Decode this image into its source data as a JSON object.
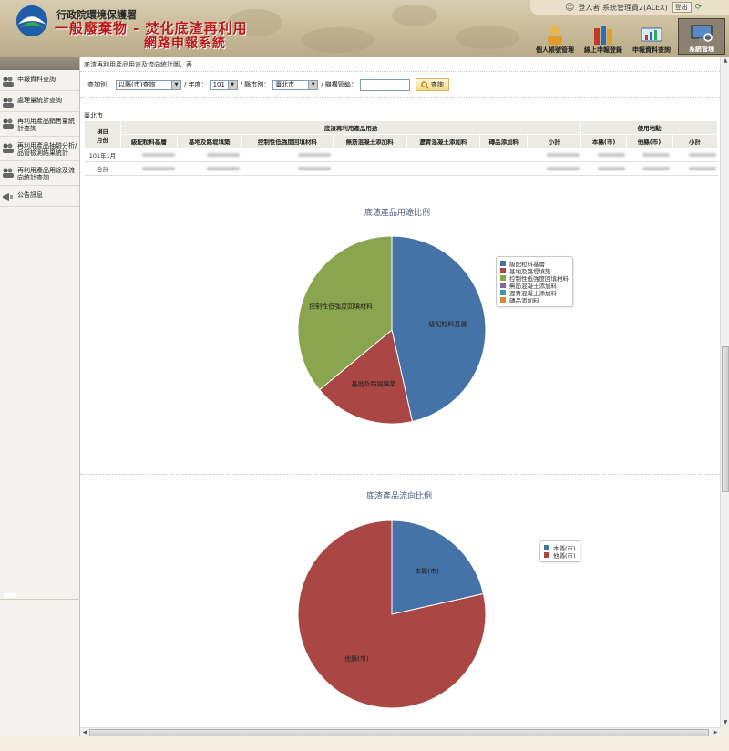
{
  "header": {
    "org": "行政院環境保護署",
    "title1": "一般廢棄物 - 焚化底渣再利用",
    "title2": "網路申報系統",
    "user_text": "登入者 系統管理員2(ALEX)",
    "logout_label": "登出",
    "nav": [
      {
        "label": "個人帳號管理",
        "icon": "person-icon"
      },
      {
        "label": "線上申報登錄",
        "icon": "books-icon"
      },
      {
        "label": "申報資料查詢",
        "icon": "chart-icon"
      },
      {
        "label": "系統管理",
        "icon": "monitor-icon"
      }
    ]
  },
  "sidebar": {
    "items": [
      {
        "label": "申報資料查詢"
      },
      {
        "label": "處理量統計查詢"
      },
      {
        "label": "再利用產品銷售量統計查詢"
      },
      {
        "label": "再利用產品抽驗分析/品管檢測結果統計"
      },
      {
        "label": "再利用產品用途及流向統計查詢"
      },
      {
        "label": "公告訊息"
      }
    ]
  },
  "breadcrumb": "底渣再利用產品用途及流向統計圖、表",
  "query": {
    "by_label": "查詢別：",
    "by_value": "以縣(市)查詢",
    "year_label": "/ 年度：",
    "year_value": "101",
    "county_label": "/ 縣市別：",
    "county_value": "臺北市",
    "keyword_label": "/ 機構管編：",
    "keyword_value": "",
    "search_label": "查詢"
  },
  "table": {
    "city": "臺北市",
    "group_usage": "底渣再利用產品用途",
    "group_location": "使用地點",
    "col_item": "項目",
    "col_month": "月份",
    "columns": [
      "級配粒料基層",
      "基地及路堤填築",
      "控制性低強度回填材料",
      "無筋混凝土添加料",
      "瀝青混凝土添加料",
      "磚品添加料",
      "小計",
      "本縣(市)",
      "他縣(市)",
      "小計"
    ],
    "rows": [
      {
        "label": "101年1月"
      },
      {
        "label": "合計"
      }
    ]
  },
  "charts": {
    "usage_title": "底渣產品用途比例",
    "flow_title": "底渣產品流向比例"
  },
  "chart_data": [
    {
      "type": "pie",
      "title": "底渣產品用途比例",
      "labels": [
        "級配粒料基層",
        "基地及路堤填築",
        "控制性低強度回填材料",
        "無筋混凝土添加料",
        "瀝青混凝土添加料",
        "磚品添加料"
      ],
      "values": [
        46.5,
        17.5,
        36.0,
        0,
        0,
        0
      ],
      "colors": [
        "#4572a7",
        "#aa4643",
        "#89a54e",
        "#80699b",
        "#3d96ae",
        "#db843d"
      ],
      "legend": "right"
    },
    {
      "type": "pie",
      "title": "底渣產品流向比例",
      "labels": [
        "本縣(市)",
        "他縣(市)"
      ],
      "values": [
        21.5,
        78.5
      ],
      "colors": [
        "#4572a7",
        "#aa4643"
      ],
      "legend": "right"
    }
  ]
}
